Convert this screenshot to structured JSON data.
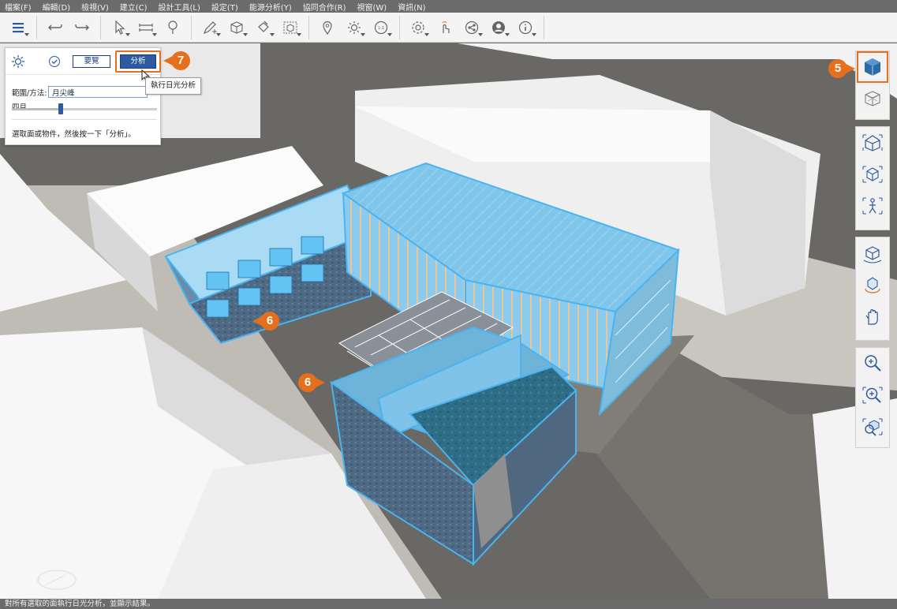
{
  "menu": [
    "檔案(F)",
    "編輯(D)",
    "檢視(V)",
    "建立(C)",
    "設計工具(L)",
    "設定(T)",
    "能源分析(Y)",
    "協同合作(R)",
    "視窗(W)",
    "資訊(N)"
  ],
  "toolbar_icons": [
    "layers-icon",
    "undo-icon",
    "redo-icon",
    "select-icon",
    "measure-icon",
    "balloon-icon",
    "sketch-icon",
    "cube-add-icon",
    "paint-icon",
    "box-select-icon",
    "location-pin-icon",
    "sun-icon",
    "scale-icon",
    "settings-icon",
    "touch-icon",
    "share-icon",
    "user-icon",
    "info-icon"
  ],
  "panel": {
    "reset_label": "要覽",
    "analyze_label": "分析",
    "range_label": "範圍/方法:",
    "range_value": "月尖峰",
    "month_label": "四月",
    "month_slider_fraction": 0.33,
    "hint": "選取面或物件，然後按一下「分析」。",
    "tooltip": "執行日光分析"
  },
  "callouts": {
    "analyze": "7",
    "view_cube": "5",
    "selection_a": "6",
    "selection_b": "6"
  },
  "status": "對所有選取的面執行日光分析，並顯示結果。",
  "colors": {
    "accent": "#e56f1c",
    "selection": "#4ab4f0",
    "button": "#2d5aa0"
  }
}
